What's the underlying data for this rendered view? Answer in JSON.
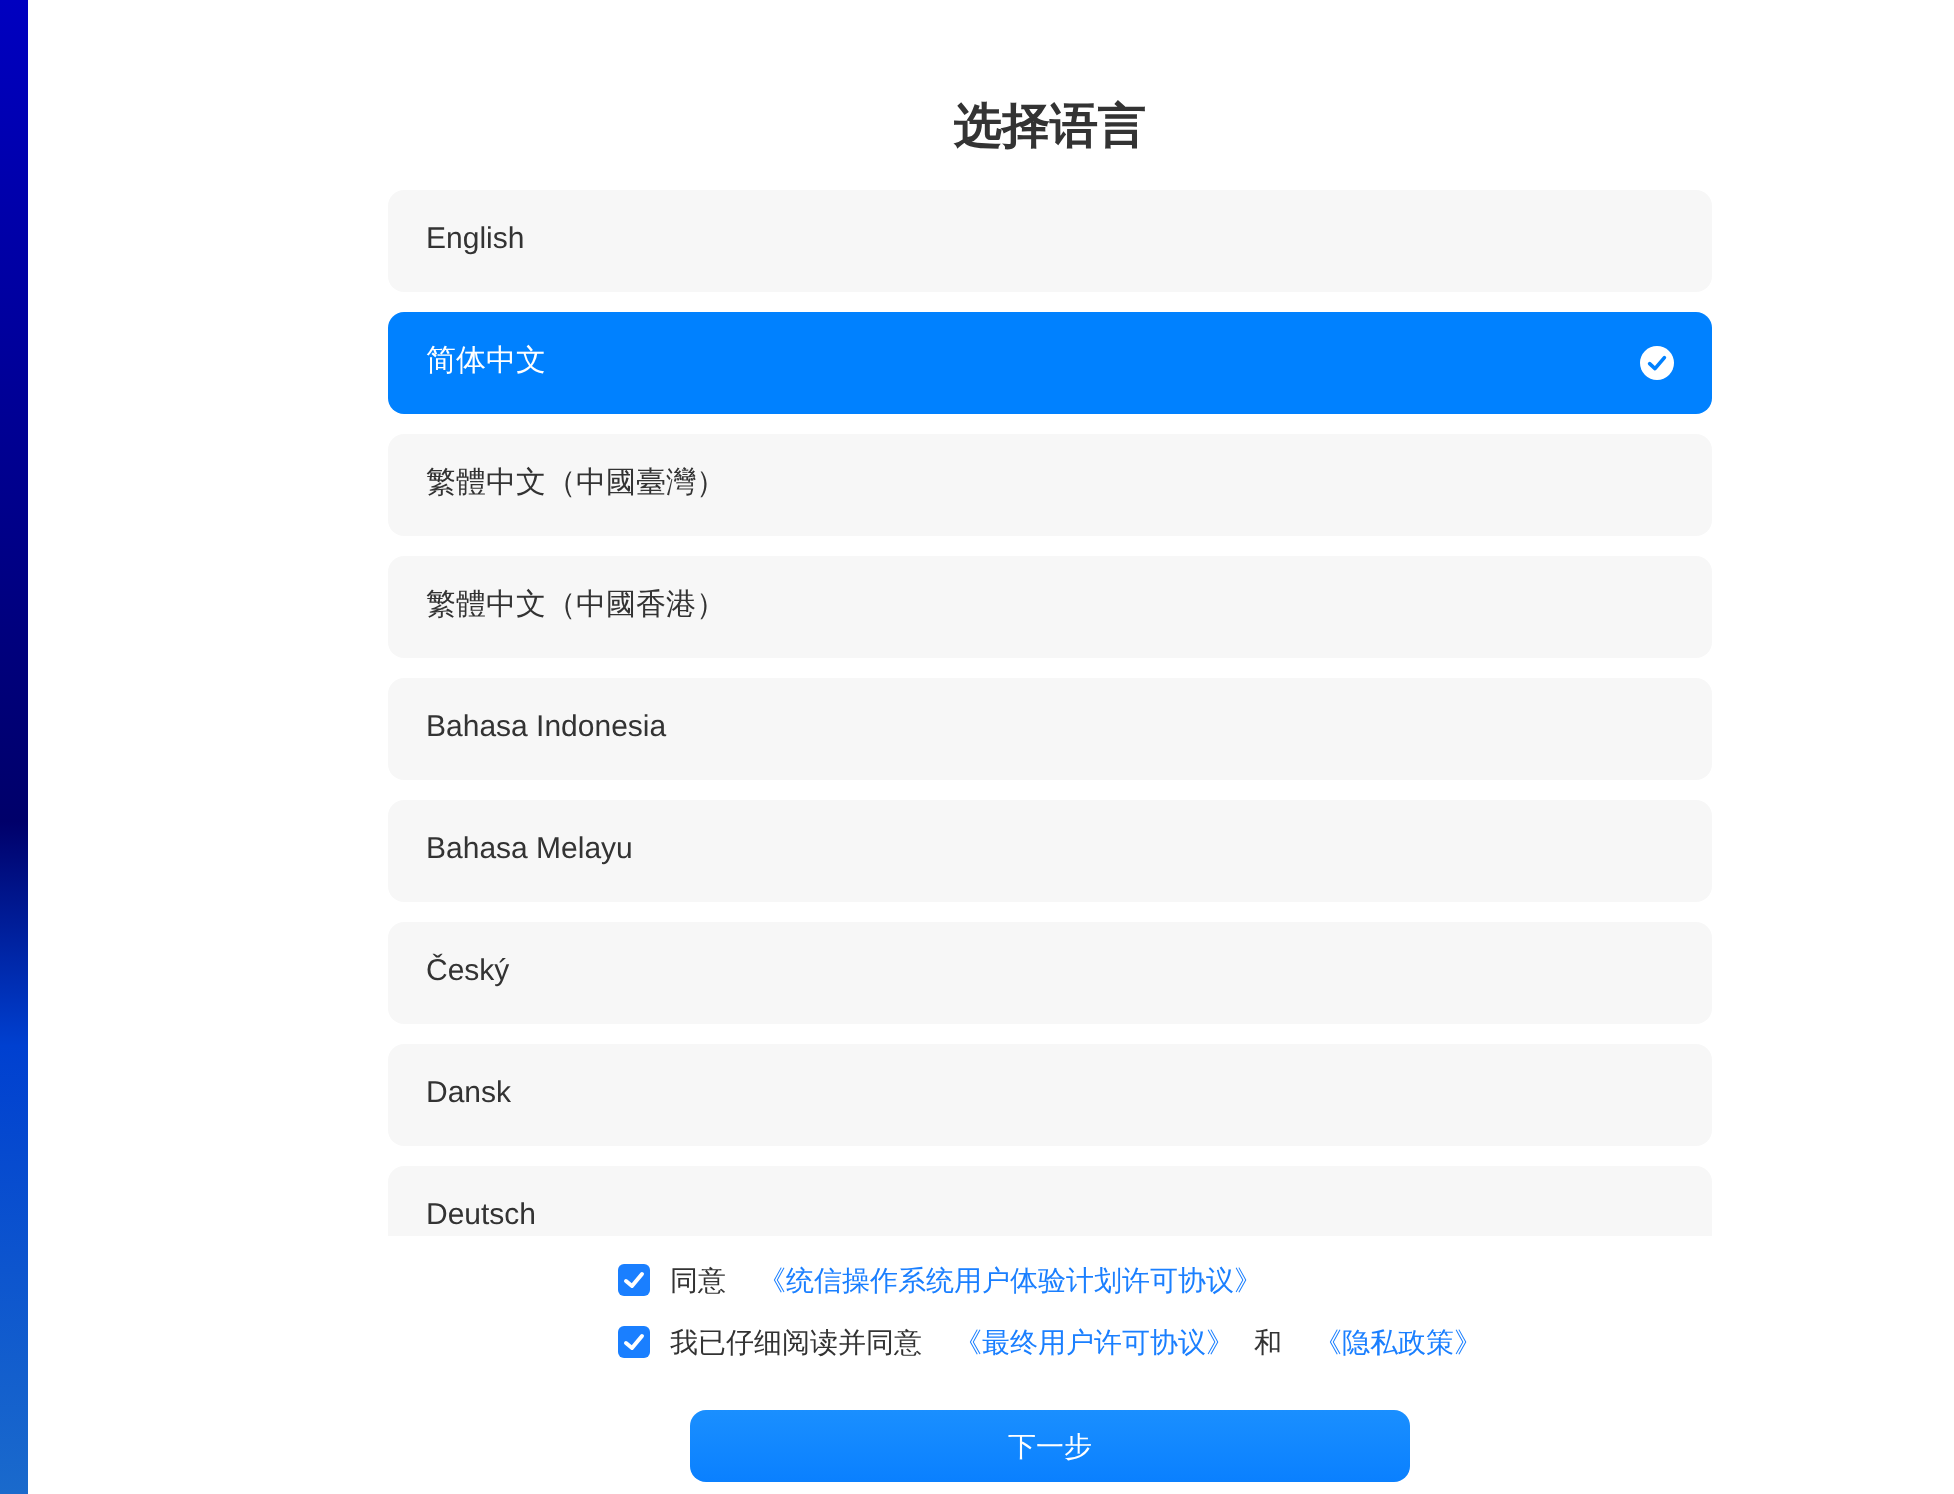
{
  "title": "选择语言",
  "languages": [
    {
      "label": "English",
      "selected": false
    },
    {
      "label": "简体中文",
      "selected": true
    },
    {
      "label": "繁體中文（中國臺灣）",
      "selected": false
    },
    {
      "label": "繁體中文（中國香港）",
      "selected": false
    },
    {
      "label": "Bahasa Indonesia",
      "selected": false
    },
    {
      "label": "Bahasa Melayu",
      "selected": false
    },
    {
      "label": "Český",
      "selected": false
    },
    {
      "label": "Dansk",
      "selected": false
    },
    {
      "label": "Deutsch",
      "selected": false
    }
  ],
  "agreements": [
    {
      "checked": true,
      "parts": [
        {
          "kind": "text",
          "text": "同意"
        },
        {
          "kind": "link",
          "text": "《统信操作系统用户体验计划许可协议》"
        }
      ]
    },
    {
      "checked": true,
      "parts": [
        {
          "kind": "text",
          "text": "我已仔细阅读并同意"
        },
        {
          "kind": "link",
          "text": "《最终用户许可协议》"
        },
        {
          "kind": "text",
          "text": "和"
        },
        {
          "kind": "link",
          "text": "《隐私政策》"
        }
      ]
    }
  ],
  "next_button": "下一步"
}
